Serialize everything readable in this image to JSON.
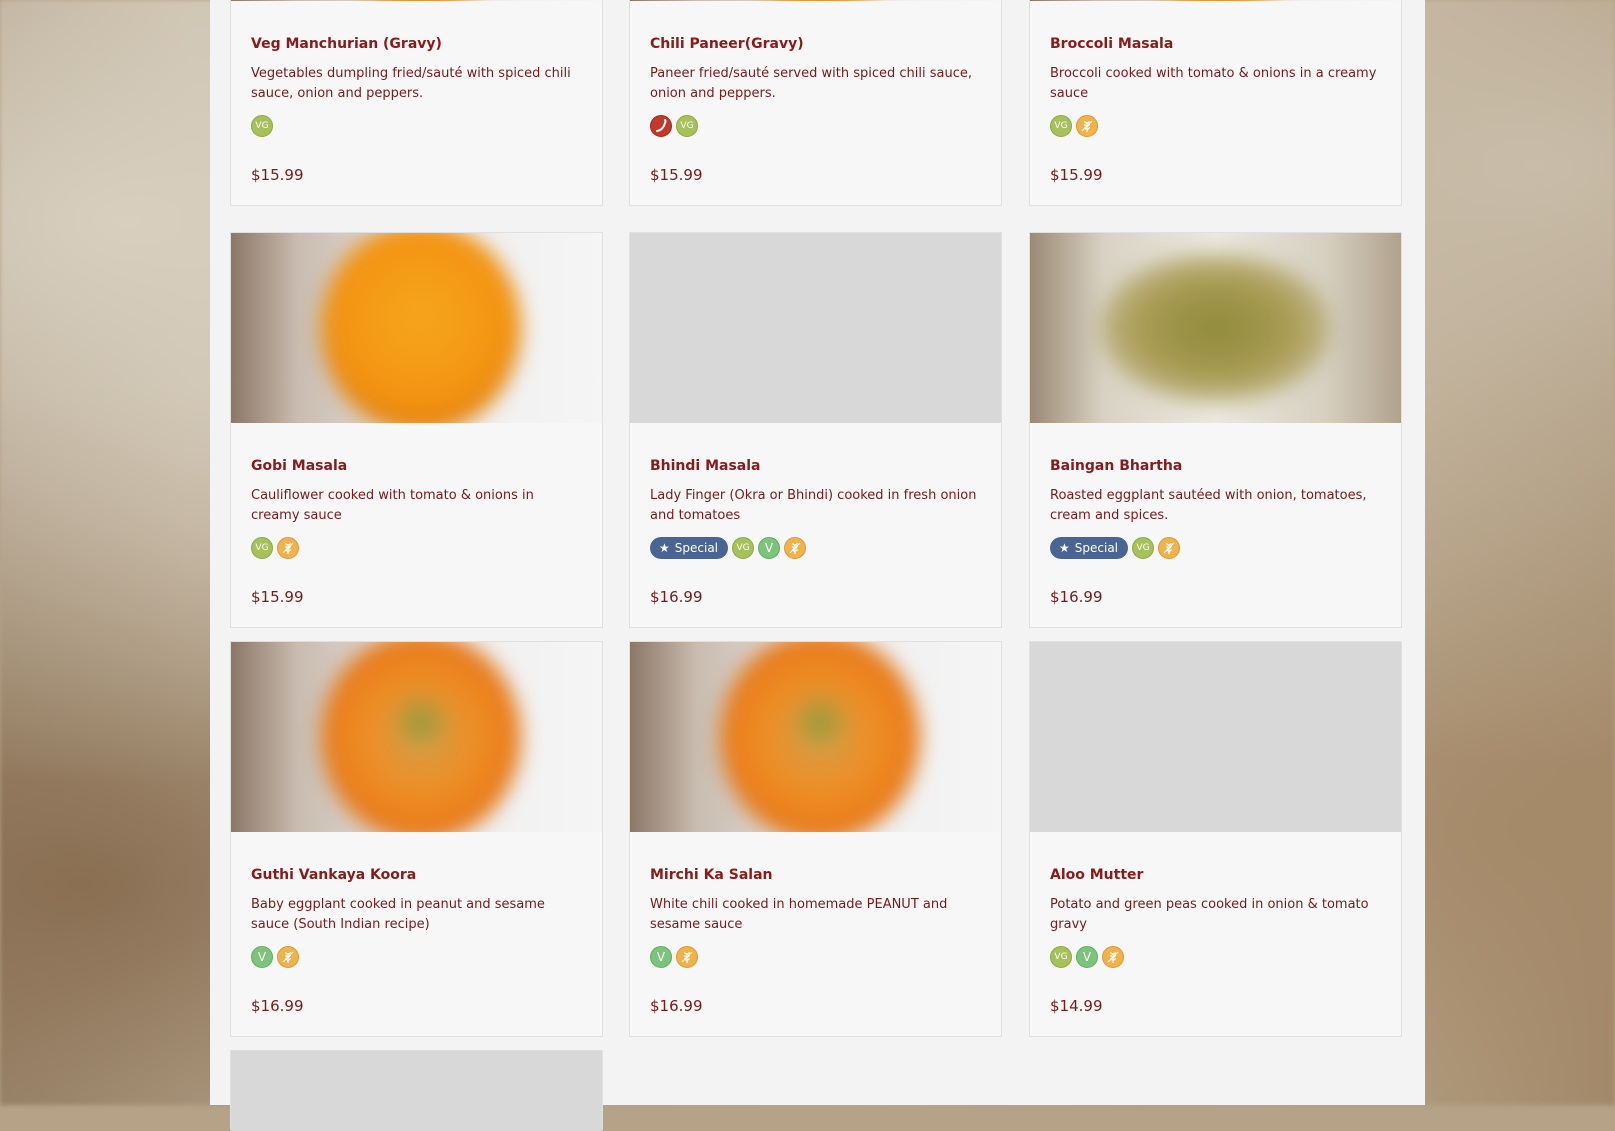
{
  "colors": {
    "title": "#8b1a1a",
    "text": "#7a1a1a",
    "vg_badge": "#a6c05a",
    "v_badge": "#7cc47c",
    "gf_badge": "#f0b24a",
    "spicy_badge": "#c0392b",
    "special_badge": "#4a6593"
  },
  "badges": {
    "vg": "VG",
    "v": "V",
    "special": "Special",
    "gf_icon": "wheat-icon",
    "spicy_icon": "chili-icon",
    "special_icon": "star-icon"
  },
  "menu_items": [
    {
      "name": "Veg Manchurian (Gravy)",
      "description": "Vegetables dumpling fried/sauté with spiced chili sauce, onion and peppers.",
      "price": "$15.99",
      "tags": [
        "vg"
      ],
      "special": false
    },
    {
      "name": "Chili Paneer(Gravy)",
      "description": "Paneer fried/sauté served with spiced chili sauce, onion and peppers.",
      "price": "$15.99",
      "tags": [
        "spicy",
        "vg"
      ],
      "special": false
    },
    {
      "name": "Broccoli Masala",
      "description": "Broccoli cooked with tomato & onions in a creamy sauce",
      "price": "$15.99",
      "tags": [
        "vg",
        "gf"
      ],
      "special": false
    },
    {
      "name": "Gobi Masala",
      "description": "Cauliflower cooked with tomato & onions in creamy sauce",
      "price": "$15.99",
      "tags": [
        "vg",
        "gf"
      ],
      "special": false,
      "image": "curry"
    },
    {
      "name": "Bhindi Masala",
      "description": "Lady Finger (Okra or Bhindi) cooked in fresh onion and tomatoes",
      "price": "$16.99",
      "tags": [
        "vg",
        "v",
        "gf"
      ],
      "special": true,
      "image": "placeholder"
    },
    {
      "name": "Baingan Bhartha",
      "description": "Roasted eggplant sautéed with onion, tomatoes, cream and spices.",
      "price": "$16.99",
      "tags": [
        "vg",
        "gf"
      ],
      "special": true,
      "image": "bharta"
    },
    {
      "name": "Guthi Vankaya Koora",
      "description": "Baby eggplant cooked in peanut and sesame sauce (South Indian recipe)",
      "price": "$16.99",
      "tags": [
        "v",
        "gf"
      ],
      "special": false,
      "image": "curry2"
    },
    {
      "name": "Mirchi Ka Salan",
      "description": "White chili cooked in homemade PEANUT and sesame sauce",
      "price": "$16.99",
      "tags": [
        "v",
        "gf"
      ],
      "special": false,
      "image": "curry2"
    },
    {
      "name": "Aloo Mutter",
      "description": "Potato and green peas cooked in onion & tomato gravy",
      "price": "$14.99",
      "tags": [
        "vg",
        "v",
        "gf"
      ],
      "special": false,
      "image": "placeholder"
    }
  ]
}
